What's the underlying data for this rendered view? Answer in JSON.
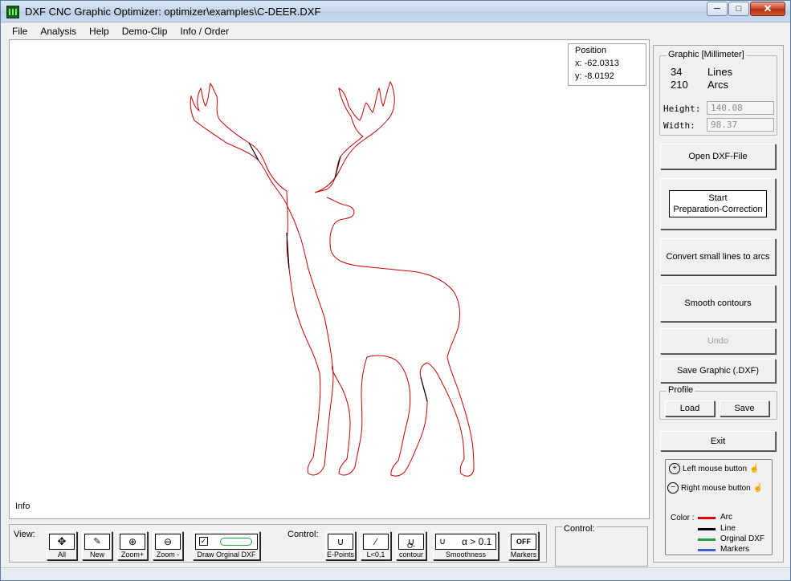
{
  "window": {
    "title": "DXF CNC Graphic Optimizer: optimizer\\examples\\C-DEER.DXF"
  },
  "menu": [
    "File",
    "Analysis",
    "Help",
    "Demo-Clip",
    "Info / Order"
  ],
  "position": {
    "legend": "Position",
    "x": "x: -62.0313",
    "y": "y: -8.0192"
  },
  "canvas": {
    "info_label": "Info"
  },
  "graphic": {
    "legend": "Graphic [Millimeter]",
    "lines_count": "34",
    "lines_label": "Lines",
    "arcs_count": "210",
    "arcs_label": "Arcs",
    "height_label": "Height:",
    "height_value": "140.08",
    "width_label": "Width:",
    "width_value": "98.37"
  },
  "buttons": {
    "open": "Open DXF-File",
    "start_line1": "Start",
    "start_line2": "Preparation-Correction",
    "convert": "Convert small lines to arcs",
    "smooth": "Smooth contours",
    "undo": "Undo",
    "save_graphic": "Save Graphic (.DXF)",
    "exit": "Exit"
  },
  "profile": {
    "legend": "Profile",
    "load": "Load",
    "save": "Save"
  },
  "mouse_help": {
    "left": "Left mouse button",
    "right": "Right mouse button"
  },
  "color_legend": {
    "title": "Color :",
    "items": [
      {
        "label": "Arc",
        "color": "#e00000"
      },
      {
        "label": "Line",
        "color": "#000000"
      },
      {
        "label": "Orginal DXF",
        "color": "#20a040"
      },
      {
        "label": "Markers",
        "color": "#4060d0"
      }
    ]
  },
  "toolbar": {
    "view_label": "View:",
    "all": "All",
    "new": "New",
    "zoom_in": "Zoom+",
    "zoom_out": "Zoom -",
    "draw_original": "Draw Orginal DXF",
    "control_label": "Control:",
    "e_points": "E-Points",
    "l_small": "L<0,1",
    "o_contour": "O-contour",
    "smoothness": "Smoothness",
    "smooth_value": "α > 0.1",
    "markers": "Markers",
    "markers_state": "OFF"
  },
  "control_panel": {
    "legend": "Control:"
  },
  "colors": {
    "arc": "#cc0000",
    "line": "#000000"
  }
}
